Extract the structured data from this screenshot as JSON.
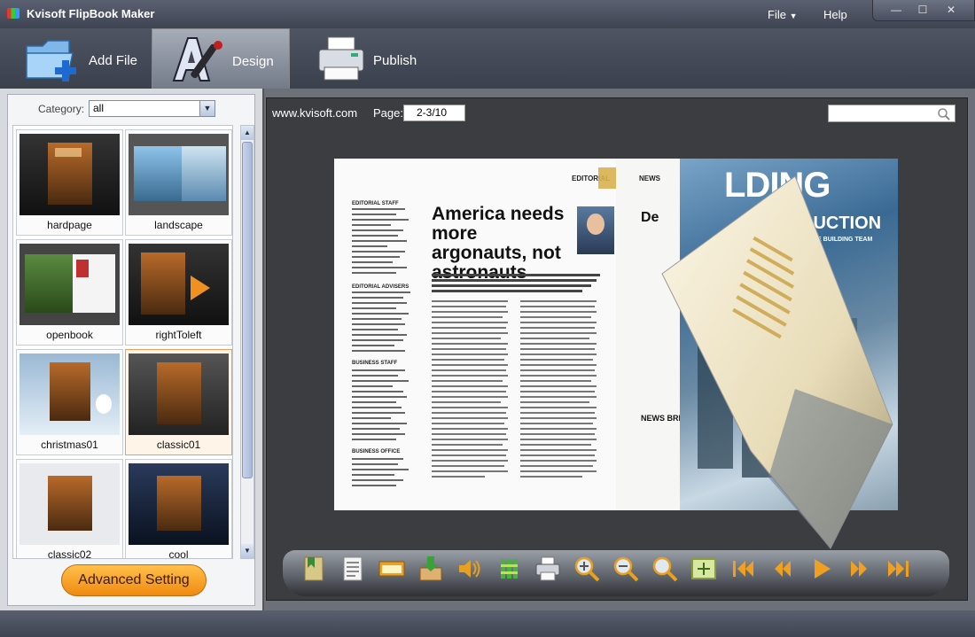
{
  "window": {
    "title": "Kvisoft FlipBook Maker",
    "menu": {
      "file": "File",
      "help": "Help"
    },
    "controls": {
      "minimize": "—",
      "maximize": "☐",
      "close": "✕"
    }
  },
  "toolbar": {
    "add_file": "Add File",
    "design": "Design",
    "publish": "Publish",
    "active": "Design"
  },
  "left_panel": {
    "category_label": "Category:",
    "category_value": "all",
    "templates": [
      {
        "label": "hardpage"
      },
      {
        "label": "landscape"
      },
      {
        "label": "openbook"
      },
      {
        "label": "rightToleft"
      },
      {
        "label": "christmas01"
      },
      {
        "label": "classic01",
        "selected": true
      },
      {
        "label": "classic02"
      },
      {
        "label": "cool"
      }
    ],
    "advanced_button": "Advanced Setting"
  },
  "preview": {
    "site": "www.kvisoft.com",
    "page_label": "Page:",
    "page_value": "2-3/10",
    "search_placeholder": "",
    "book": {
      "headline": "America needs more argonauts, not astronauts",
      "section_editorial": "EDITORIAL",
      "section_news": "NEWS",
      "news_briefs": "NEWS BRIEFS",
      "magazine_title": "LDING",
      "magazine_subtitle": "CONSTRUCTION",
      "magazine_tagline": "INSPIRING THE BUILDING TEAM",
      "editorial_staff": "EDITORIAL STAFF",
      "editorial_advisers": "EDITORIAL ADVISERS",
      "business_staff": "BUSINESS STAFF",
      "business_office": "BUSINESS OFFICE"
    },
    "controls": [
      "bookmark-icon",
      "table-of-contents-icon",
      "thumbnails-icon",
      "download-icon",
      "sound-icon",
      "share-icon",
      "print-icon",
      "zoom-in-icon",
      "zoom-out-icon",
      "magnifier-icon",
      "fit-screen-icon",
      "first-page-icon",
      "previous-page-icon",
      "play-icon",
      "next-page-icon",
      "last-page-icon"
    ]
  }
}
